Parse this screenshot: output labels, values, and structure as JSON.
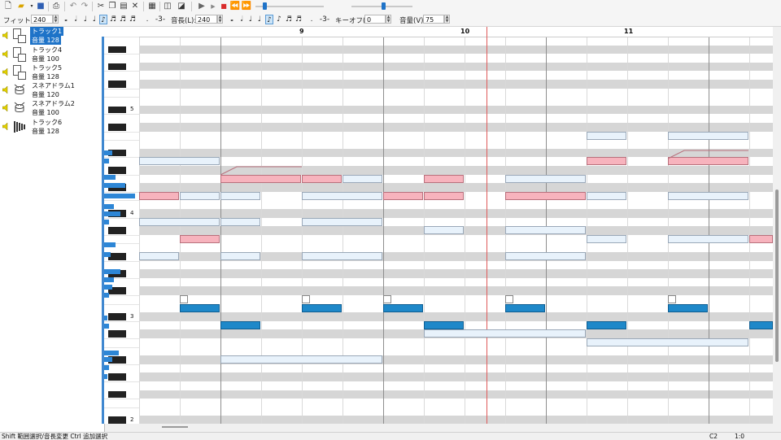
{
  "toolbar": {
    "fit_label": "フィット(F):",
    "fit_value": "240",
    "length_label": "音長(L):",
    "length_value": "240",
    "keyoff_label": "キーオフ(K):",
    "keyoff_value": "0",
    "volume_label": "音量(V):",
    "volume_value": "75"
  },
  "tracks": [
    {
      "name": "トラック1",
      "volume": "音量 128",
      "icon": "piano-icon",
      "selected": true
    },
    {
      "name": "トラック4",
      "volume": "音量 100",
      "icon": "piano-icon",
      "selected": false
    },
    {
      "name": "トラック5",
      "volume": "音量 128",
      "icon": "piano-icon",
      "selected": false
    },
    {
      "name": "スネアドラム1",
      "volume": "音量 120",
      "icon": "drum-icon",
      "selected": false
    },
    {
      "name": "スネアドラム2",
      "volume": "音量 100",
      "icon": "drum-icon",
      "selected": false
    },
    {
      "name": "トラック6",
      "volume": "音量 128",
      "icon": "xylophone-icon",
      "selected": false
    }
  ],
  "ruler": {
    "bars": [
      "9",
      "10",
      "11"
    ]
  },
  "octave_labels": [
    "5",
    "4",
    "3",
    "2"
  ],
  "status": {
    "hint": "Shift 範囲選択/音長変更  Ctrl 追加選択",
    "note_name": "C2",
    "position": "1:0"
  },
  "colors": {
    "selected_track": "#1e73c8",
    "note_light": "#e8f2fb",
    "note_pink": "#f7b3bd",
    "note_blue": "#1e88c9",
    "playhead": "#e05a5a"
  }
}
